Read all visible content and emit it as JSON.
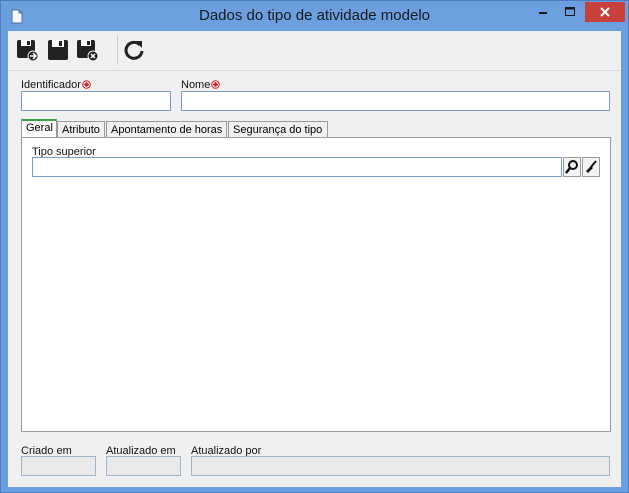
{
  "window": {
    "title": "Dados do tipo de atividade modelo"
  },
  "toolbar": {
    "buttons": [
      {
        "name": "save-and-new",
        "icon": "save-new-icon"
      },
      {
        "name": "save",
        "icon": "save-icon"
      },
      {
        "name": "save-and-close",
        "icon": "save-close-icon"
      },
      {
        "name": "refresh",
        "icon": "refresh-icon"
      }
    ]
  },
  "form": {
    "identificador_label": "Identificador",
    "identificador_value": "",
    "nome_label": "Nome",
    "nome_value": ""
  },
  "tabs": [
    {
      "label": "Geral",
      "active": true
    },
    {
      "label": "Atributo",
      "active": false
    },
    {
      "label": "Apontamento de horas",
      "active": false
    },
    {
      "label": "Segurança do tipo",
      "active": false
    }
  ],
  "geral": {
    "tipo_superior_label": "Tipo superior",
    "tipo_superior_value": ""
  },
  "footer": {
    "criado_em_label": "Criado em",
    "atualizado_em_label": "Atualizado em",
    "atualizado_por_label": "Atualizado por"
  },
  "colors": {
    "titlebar": "#6c9fe0",
    "close_button": "#c7403a",
    "required_marker": "#d0202a",
    "active_tab_accent": "#3aa64a"
  }
}
